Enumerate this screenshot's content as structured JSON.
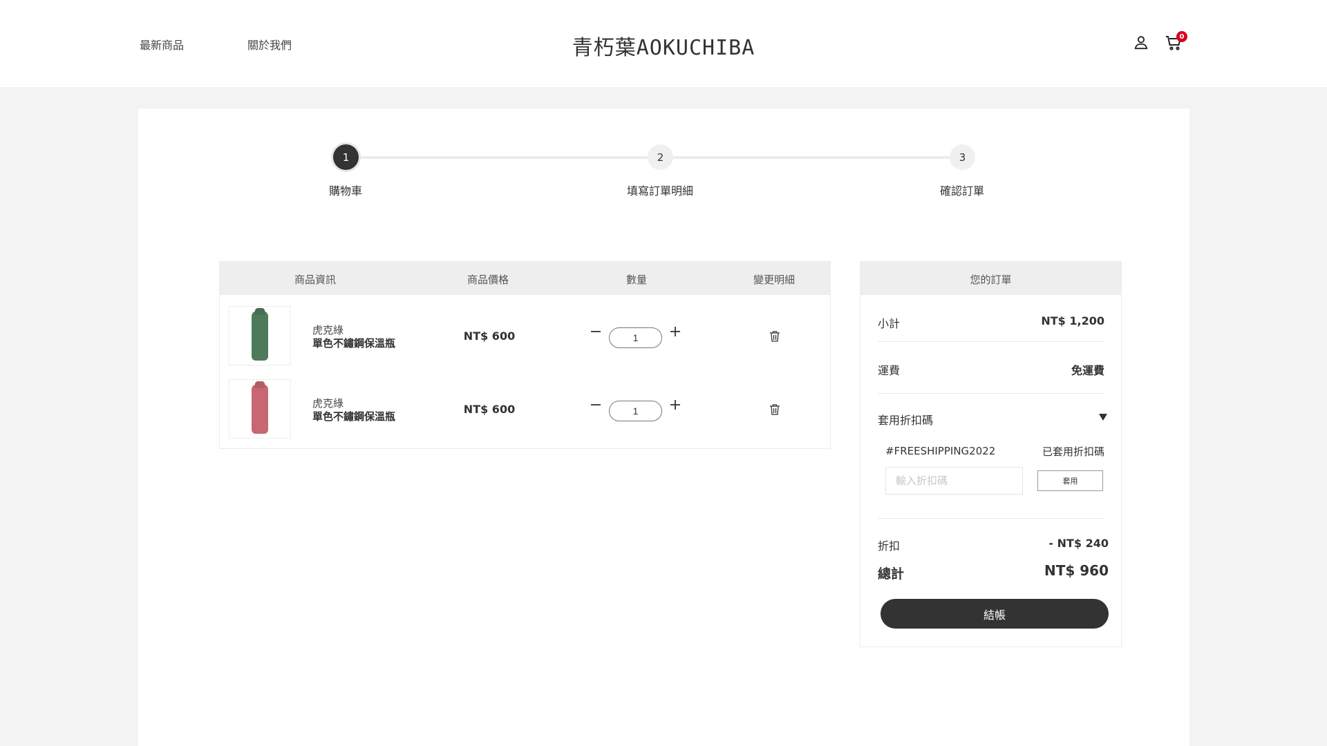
{
  "header": {
    "nav": [
      {
        "label": "最新商品"
      },
      {
        "label": "關於我們"
      }
    ],
    "logo": "青朽葉AOKUCHIBA",
    "cart_count": "0",
    "icons": [
      "user-icon",
      "cart-icon"
    ]
  },
  "stepper": {
    "steps": [
      {
        "number": "1",
        "label": "購物車",
        "active": true
      },
      {
        "number": "2",
        "label": "填寫訂單明細",
        "active": false
      },
      {
        "number": "3",
        "label": "確認訂單",
        "active": false
      }
    ]
  },
  "cart": {
    "headers": [
      "商品資訊",
      "商品價格",
      "數量",
      "變更明細"
    ],
    "items": [
      {
        "brand": "虎克綠",
        "name": "單色不鏽鋼保溫瓶",
        "price": "NT$ 600",
        "qty": "1",
        "color": "#4e7a5c"
      },
      {
        "brand": "虎克綠",
        "name": "單色不鏽鋼保溫瓶",
        "price": "NT$ 600",
        "qty": "1",
        "color": "#c86672"
      }
    ],
    "icons": [
      "minus-icon",
      "plus-icon",
      "trash-icon"
    ]
  },
  "summary": {
    "title": "您的訂單",
    "subtotal_label": "小計",
    "subtotal_value": "NT$ 1,200",
    "shipping_label": "運費",
    "shipping_value": "免運費",
    "coupon_label": "套用折扣碼",
    "coupon_code": "#FREESHIPPING2022",
    "coupon_status": "已套用折扣碼",
    "coupon_placeholder": "輸入折扣碼",
    "apply_label": "套用",
    "discount_label": "折扣",
    "discount_value": "- NT$ 240",
    "total_label": "總計",
    "total_value": "NT$ 960",
    "checkout_label": "結帳"
  },
  "colors": {
    "accent": "#333333",
    "badge": "#d9001b",
    "page_bg": "#f3f3f4"
  }
}
